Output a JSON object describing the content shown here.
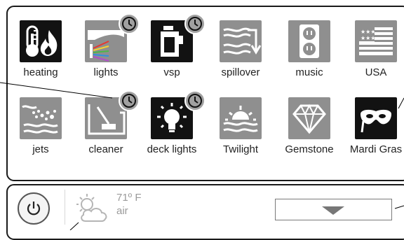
{
  "tiles": [
    {
      "label": "heating",
      "icon": "thermometer-flame-icon",
      "scheduled": false
    },
    {
      "label": "lights",
      "icon": "light-beam-icon",
      "scheduled": true
    },
    {
      "label": "vsp",
      "icon": "pump-icon",
      "scheduled": true
    },
    {
      "label": "spillover",
      "icon": "spillover-icon",
      "scheduled": false
    },
    {
      "label": "music",
      "icon": "outlet-icon",
      "scheduled": false
    },
    {
      "label": "USA",
      "icon": "usa-flag-icon",
      "scheduled": false
    },
    {
      "label": "jets",
      "icon": "jets-icon",
      "scheduled": false
    },
    {
      "label": "cleaner",
      "icon": "pool-cleaner-icon",
      "scheduled": true
    },
    {
      "label": "deck lights",
      "icon": "light-bulb-icon",
      "scheduled": true
    },
    {
      "label": "Twilight",
      "icon": "sunset-icon",
      "scheduled": false
    },
    {
      "label": "Gemstone",
      "icon": "diamond-icon",
      "scheduled": false
    },
    {
      "label": "Mardi Gras",
      "icon": "mask-icon",
      "scheduled": false
    }
  ],
  "weather": {
    "temperature": "71º F",
    "source": "air",
    "icon": "partly-cloudy-icon"
  },
  "colors": {
    "dark_tile": "#121212",
    "gray_tile": "#8f8f8f",
    "clock_badge": "#a0a0a0",
    "weather_text": "#9a9a9a"
  }
}
